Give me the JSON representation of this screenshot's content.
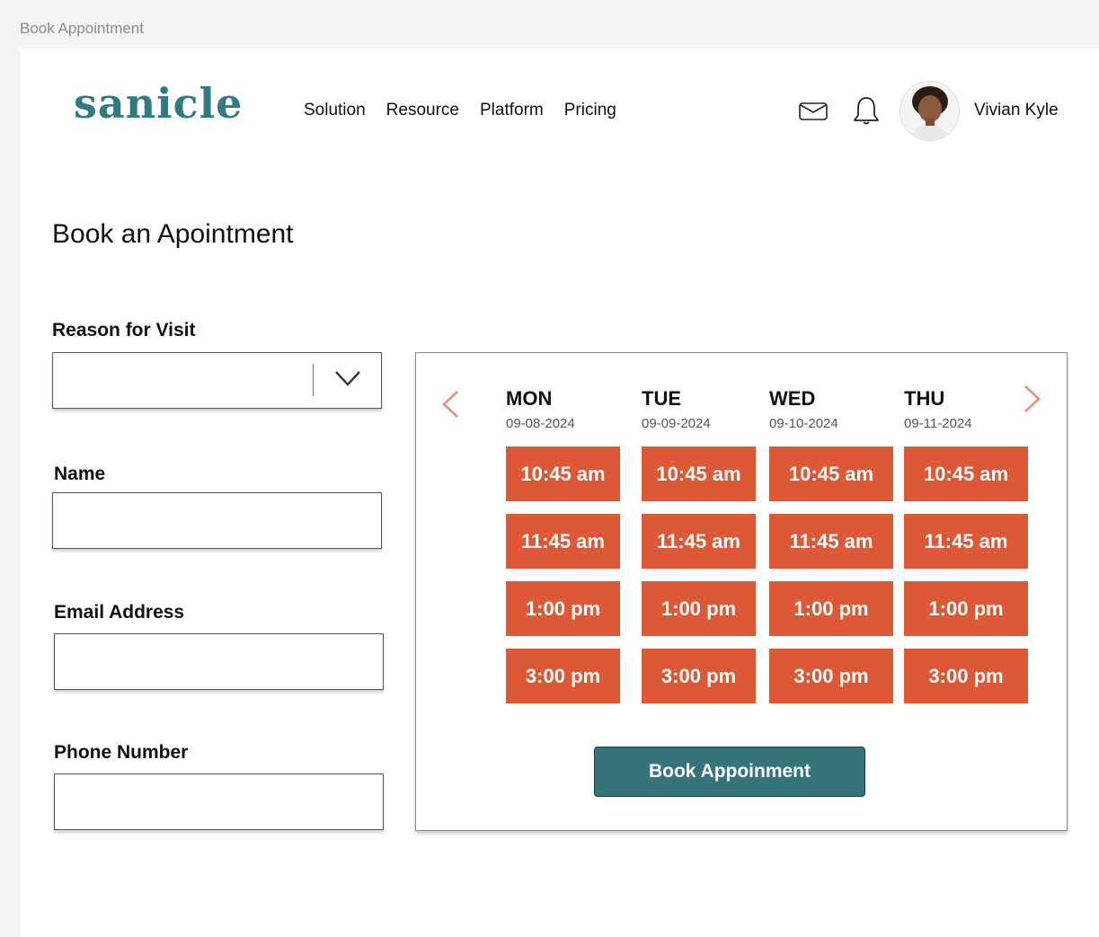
{
  "window": {
    "title": "Book Appointment"
  },
  "header": {
    "logo_text": "sanicle",
    "nav": [
      "Solution",
      "Resource",
      "Platform",
      "Pricing"
    ],
    "user_name": "Vivian Kyle",
    "icons": [
      "mail-icon",
      "bell-icon"
    ]
  },
  "page": {
    "title": "Book an Apointment"
  },
  "form": {
    "reason": {
      "label": "Reason for Visit",
      "value": ""
    },
    "name": {
      "label": "Name",
      "value": ""
    },
    "email": {
      "label": "Email Address",
      "value": ""
    },
    "phone": {
      "label": "Phone Number",
      "value": ""
    }
  },
  "calendar": {
    "days": [
      {
        "name": "MON",
        "date": "09-08-2024",
        "slots": [
          "10:45 am",
          "11:45 am",
          "1:00 pm",
          "3:00 pm"
        ]
      },
      {
        "name": "TUE",
        "date": "09-09-2024",
        "slots": [
          "10:45 am",
          "11:45 am",
          "1:00 pm",
          "3:00 pm"
        ]
      },
      {
        "name": "WED",
        "date": "09-10-2024",
        "slots": [
          "10:45 am",
          "11:45 am",
          "1:00 pm",
          "3:00 pm"
        ]
      },
      {
        "name": "THU",
        "date": "09-11-2024",
        "slots": [
          "10:45 am",
          "11:45 am",
          "1:00 pm",
          "3:00 pm"
        ]
      }
    ],
    "book_label": "Book Appoinment"
  },
  "colors": {
    "brand": "#2e7b83",
    "slot": "#dc5836",
    "button": "#35747b",
    "arrow": "#e8907a"
  }
}
